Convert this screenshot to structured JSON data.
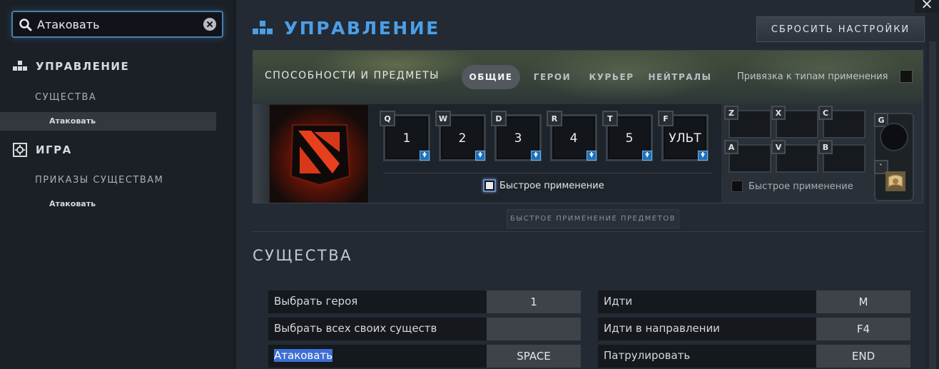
{
  "search": {
    "value": "Атаковать"
  },
  "sidebar": {
    "sections": [
      {
        "label": "УПРАВЛЕНИЕ",
        "sub": "СУЩЕСТВА",
        "leaf": "Атаковать"
      },
      {
        "label": "ИГРА",
        "sub": "ПРИКАЗЫ СУЩЕСТВАМ",
        "leaf": "Атаковать"
      }
    ]
  },
  "header": {
    "title": "УПРАВЛЕНИЕ",
    "reset_label": "СБРОСИТЬ НАСТРОЙКИ"
  },
  "abilities": {
    "title": "СПОСОБНОСТИ И ПРЕДМЕТЫ",
    "tabs": [
      "ОБЩИЕ",
      "ГЕРОИ",
      "КУРЬЕР",
      "НЕЙТРАЛЫ"
    ],
    "active_tab": "ОБЩИЕ",
    "bind_types_label": "Привязка к типам применения",
    "keys": [
      {
        "letter": "Q",
        "label": "1"
      },
      {
        "letter": "W",
        "label": "2"
      },
      {
        "letter": "D",
        "label": "3"
      },
      {
        "letter": "R",
        "label": "4"
      },
      {
        "letter": "T",
        "label": "5"
      },
      {
        "letter": "F",
        "label": "УЛЬТ"
      }
    ],
    "quick_cast_label": "Быстрое применение",
    "items": [
      "Z",
      "X",
      "C",
      "A",
      "V",
      "B"
    ],
    "items_quick_cast_label": "Быстрое применение",
    "neutral_key": "G",
    "tp_key": "`",
    "item_quick_cast_button": "БЫСТРОЕ ПРИМЕНЕНИЕ ПРЕДМЕТОВ"
  },
  "section_title": "СУЩЕСТВА",
  "bindings": {
    "left": [
      {
        "name": "Выбрать героя",
        "key": "1"
      },
      {
        "name": "Выбрать всех своих существ",
        "key": ""
      },
      {
        "name": "Атаковать",
        "key": "SPACE"
      }
    ],
    "right": [
      {
        "name": "Идти",
        "key": "M"
      },
      {
        "name": "Идти в направлении",
        "key": "F4"
      },
      {
        "name": "Патрулировать",
        "key": "END"
      }
    ]
  },
  "colors": {
    "accent_blue": "#4a9fe8",
    "highlight": "#3c6fd6"
  }
}
